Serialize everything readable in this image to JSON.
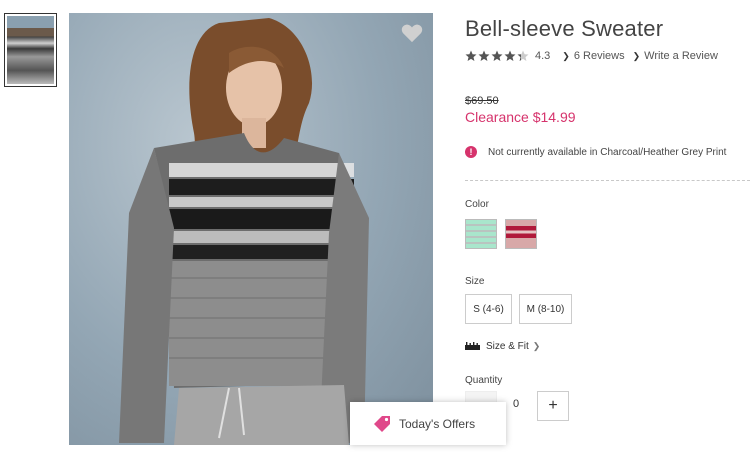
{
  "product": {
    "title": "Bell-sleeve Sweater",
    "rating": 4.3,
    "rating_text": "4.3",
    "reviews_label": "6 Reviews",
    "write_review_label": "Write a Review",
    "price_original": "$69.50",
    "price_sale": "Clearance $14.99",
    "availability_notice": "Not currently available in Charcoal/Heather Grey Print"
  },
  "options": {
    "color_label": "Color",
    "colors": [
      {
        "name": "mint stripe",
        "hex": "#a9e6cc"
      },
      {
        "name": "red stripe",
        "hex": "#b0193a"
      }
    ],
    "size_label": "Size",
    "sizes": [
      "S (4-6)",
      "M (8-10)"
    ],
    "size_fit_label": "Size & Fit",
    "quantity_label": "Quantity",
    "quantity_value": "0",
    "plus_glyph": "+"
  },
  "offers": {
    "label": "Today's Offers"
  },
  "icons": {
    "favorite": "heart-icon",
    "offers": "tag-icon",
    "size_fit": "ruler-icon",
    "alert": "alert-icon"
  },
  "colors": {
    "accent": "#d6336c",
    "text": "#444444"
  }
}
